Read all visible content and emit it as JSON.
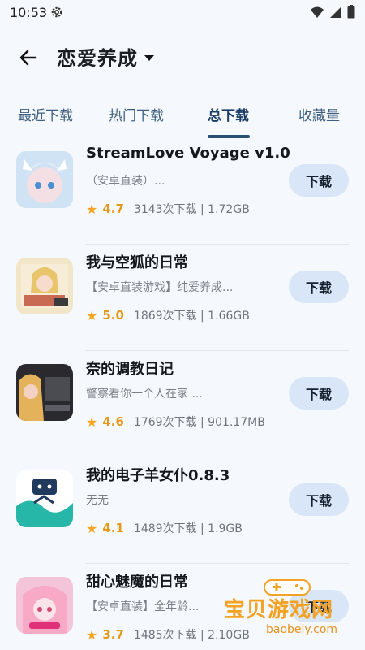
{
  "status": {
    "time": "10:53"
  },
  "header": {
    "title": "恋爱养成"
  },
  "tabs": [
    {
      "label": "最近下载"
    },
    {
      "label": "热门下载"
    },
    {
      "label": "总下载"
    },
    {
      "label": "收藏量"
    }
  ],
  "games": [
    {
      "name": "StreamLove Voyage v1.0",
      "desc": "（安卓直装）...",
      "rating": "4.7",
      "stats": "3143次下载 | 1.72GB",
      "button": "下载"
    },
    {
      "name": "我与空狐的日常",
      "desc": "【安卓直装游戏】纯爱养成...",
      "rating": "5.0",
      "stats": "1869次下载 | 1.66GB",
      "button": "下载"
    },
    {
      "name": "奈的调教日记",
      "desc": "警察看你一个人在家 ...",
      "rating": "4.6",
      "stats": "1769次下载 | 901.17MB",
      "button": "下载"
    },
    {
      "name": "我的电子羊女仆0.8.3",
      "desc": "无无",
      "rating": "4.1",
      "stats": "1489次下载 | 1.9GB",
      "button": "下载"
    },
    {
      "name": "甜心魅魔的日常",
      "desc": "【安卓直装】全年龄...",
      "rating": "3.7",
      "stats": "1485次下载 | 2.10GB",
      "button": "下载"
    }
  ],
  "watermark": {
    "text": "宝贝游戏网",
    "url": "baobeiy.com"
  },
  "colors": {
    "accent": "#2c4d74",
    "button_bg": "#d9e6f7",
    "star": "#f5a623"
  },
  "icons": {
    "back": "arrow-left-icon",
    "settings": "gear-icon",
    "dropdown": "caret-down-icon",
    "rating": "star-icon"
  }
}
